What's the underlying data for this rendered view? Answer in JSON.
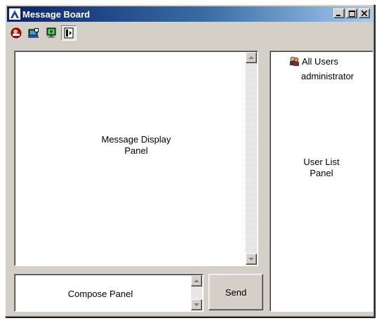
{
  "window": {
    "title": "Message Board",
    "icon": "message-board-app-icon",
    "controls": {
      "minimize": "minimize-icon",
      "maximize": "maximize-icon",
      "close": "close-icon"
    }
  },
  "toolbar": {
    "buttons": [
      {
        "icon": "do-not-disturb-icon",
        "pressed": false
      },
      {
        "icon": "broadcast-chat-icon",
        "pressed": false
      },
      {
        "icon": "occupy-keyboard-mouse-icon",
        "pressed": false
      },
      {
        "icon": "show-user-list-icon",
        "pressed": true
      }
    ]
  },
  "message_panel": {
    "line1": "Message Display",
    "line2": "Panel"
  },
  "compose_panel": {
    "label": "Compose Panel"
  },
  "send_button": {
    "label": "Send"
  },
  "user_list": {
    "group_label": "All Users",
    "users": [
      "administrator"
    ],
    "panel_line1": "User List",
    "panel_line2": "Panel"
  },
  "colors": {
    "title_bar_start": "#0a246a",
    "title_bar_end": "#a6caf0",
    "face": "#d4d0c8"
  }
}
